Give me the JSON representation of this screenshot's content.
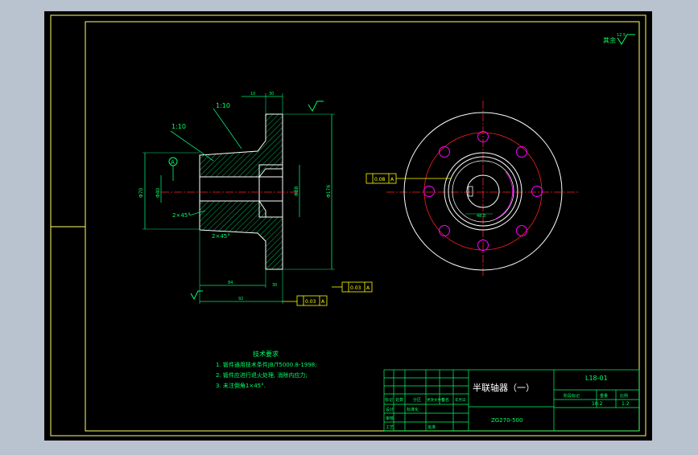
{
  "colors": {
    "background": "#b9c2cf",
    "sheet": "#000000",
    "border": "#ffff66",
    "outline": "#ffffff",
    "dimension": "#00e676",
    "centerline": "#ff2020",
    "holes": "#ff00ff",
    "hatch": "#00e676",
    "text_green": "#00ff66",
    "tolerance_box": "#ffff00"
  },
  "drawing": {
    "surface_note": "其余",
    "surface_note_value": "12.5",
    "taper_top": "1:10",
    "taper_left": "1:10",
    "datum_a": "A",
    "chamfer_1": "2×45°",
    "chamfer_2": "2×45°",
    "dim_bottom_1": "84",
    "dim_bottom_2": "92",
    "dim_bottom_3": "30",
    "dim_left": "Φ70",
    "dim_bore": "Φ40",
    "dim_right_1": "Φ88",
    "dim_right_2": "Φ176",
    "dim_top_1": "10",
    "dim_top_2": "30",
    "tolerance_1_value": "0.03",
    "tolerance_1_datum": "A",
    "tolerance_2_value": "0.03",
    "tolerance_2_datum": "A",
    "tolerance_3_value": "0.08",
    "tolerance_3_datum": "A",
    "keyway_dim": "48.8"
  },
  "notes": {
    "heading": "技术要求",
    "line1": "1. 锻件通用技术条件JB/T5000.8-1998;",
    "line2": "2. 锻件应进行退火处理, 消除内应力;",
    "line3": "3. 未注倒角1×45°."
  },
  "title_block": {
    "part_name": "半联轴器（一）",
    "drawing_number": "L18-01",
    "material": "ZG270-500",
    "scale": "1:2",
    "sheet_count": "10:2",
    "col_stage": "阶段标记",
    "col_weight": "重量",
    "col_scale": "比例",
    "row_mark": "标记",
    "row_qty": "处数",
    "row_zone": "分区",
    "row_change": "更改文件号",
    "row_sign": "签名",
    "row_date": "年月日",
    "row_design": "设计",
    "row_check": "审核",
    "row_process": "工艺",
    "row_std": "标准化",
    "row_approve": "批准"
  }
}
